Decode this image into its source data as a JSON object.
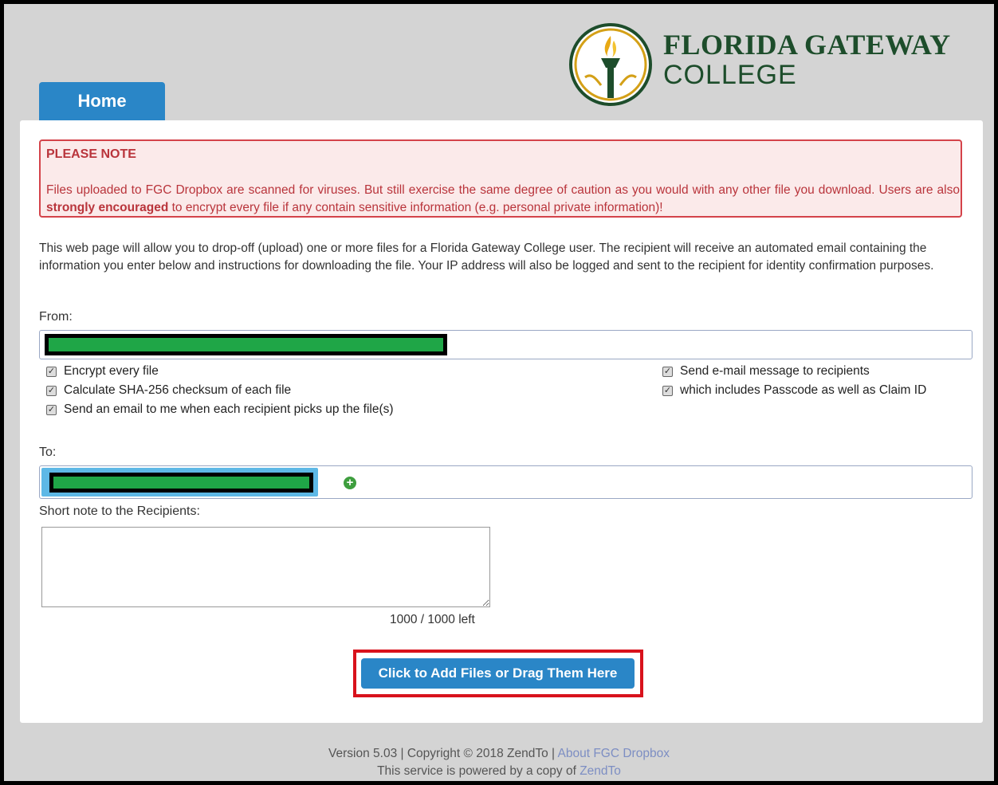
{
  "logo": {
    "line1": "FLORIDA GATEWAY",
    "line2": "COLLEGE",
    "colors": {
      "green": "#1d4d2b",
      "gold": "#d4a017"
    }
  },
  "nav": {
    "home_tab": "Home"
  },
  "notice": {
    "title": "PLEASE NOTE",
    "text_before": "Files uploaded to FGC Dropbox are scanned for viruses. But still exercise the same degree of caution as you would with any other file you download. Users are also ",
    "text_strong": "strongly encouraged",
    "text_after": " to encrypt every file if any contain sensitive information (e.g. personal private information)!"
  },
  "intro": "This web page will allow you to drop-off (upload) one or more files for a Florida Gateway College user. The recipient will receive an automated email containing the information you enter below and instructions for downloading the file. Your IP address will also be logged and sent to the recipient for identity confirmation purposes.",
  "from": {
    "label": "From:"
  },
  "options_left": [
    "Encrypt every file",
    "Calculate SHA-256 checksum of each file",
    "Send an email to me when each recipient picks up the file(s)"
  ],
  "options_right": [
    "Send e-mail message to recipients",
    "which includes Passcode as well as Claim ID"
  ],
  "to": {
    "label": "To:",
    "add_icon": "plus-circle-icon"
  },
  "note": {
    "label": "Short note to the Recipients:",
    "counter": "1000 / 1000 left"
  },
  "upload_button": "Click to Add Files or Drag Them Here",
  "footer": {
    "version_text": "Version 5.03 | Copyright © 2018 ZendTo | ",
    "about_link": "About FGC Dropbox",
    "powered_text": "This service is powered by a copy of ",
    "zendto_link": "ZendTo"
  },
  "colors": {
    "accent": "#2a86c7",
    "notice_red": "#d4434a",
    "highlight_red": "#d8121c"
  }
}
